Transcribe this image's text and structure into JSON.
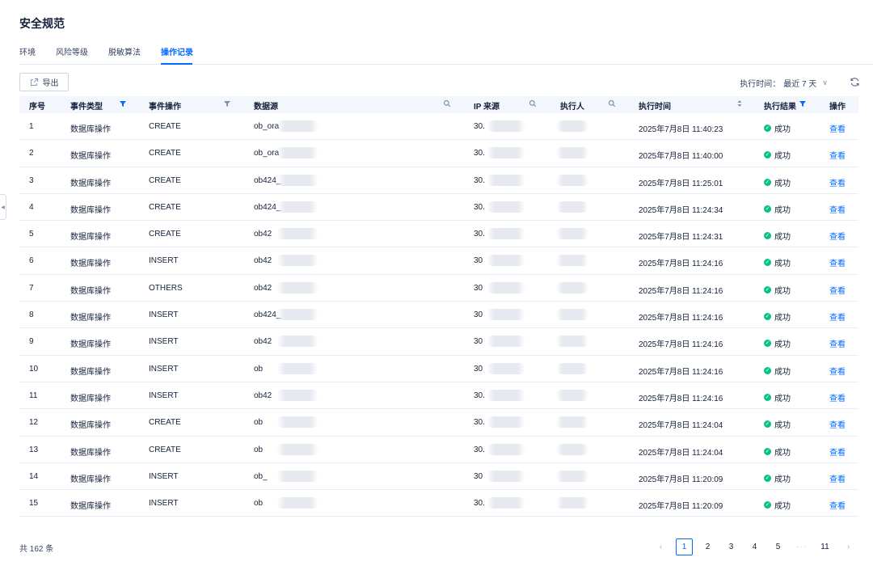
{
  "page": {
    "title": "安全规范",
    "tabs": [
      "环境",
      "风险等级",
      "脱敏算法",
      "操作记录"
    ],
    "active_tab": "操作记录"
  },
  "toolbar": {
    "export_label": "导出",
    "time_filter_label": "执行时间：",
    "time_filter_value": "最近 7 天"
  },
  "table": {
    "columns": {
      "index": "序号",
      "event_type": "事件类型",
      "event_op": "事件操作",
      "datasource": "数据源",
      "ip": "IP 来源",
      "executor": "执行人",
      "time": "执行时间",
      "result": "执行结果",
      "action": "操作"
    },
    "rows": [
      {
        "index": "1",
        "event_type": "数据库操作",
        "event_op": "CREATE",
        "datasource": "ob_ora",
        "ip": "30.",
        "time": "2025年7月8日 11:40:23",
        "result": "成功",
        "action": "查看"
      },
      {
        "index": "2",
        "event_type": "数据库操作",
        "event_op": "CREATE",
        "datasource": "ob_ora",
        "ip": "30.",
        "time": "2025年7月8日 11:40:00",
        "result": "成功",
        "action": "查看"
      },
      {
        "index": "3",
        "event_type": "数据库操作",
        "event_op": "CREATE",
        "datasource": "ob424_",
        "ip": "30.",
        "time": "2025年7月8日 11:25:01",
        "result": "成功",
        "action": "查看"
      },
      {
        "index": "4",
        "event_type": "数据库操作",
        "event_op": "CREATE",
        "datasource": "ob424_",
        "ip": "30.",
        "time": "2025年7月8日 11:24:34",
        "result": "成功",
        "action": "查看"
      },
      {
        "index": "5",
        "event_type": "数据库操作",
        "event_op": "CREATE",
        "datasource": "ob42",
        "ip": "30.",
        "time": "2025年7月8日 11:24:31",
        "result": "成功",
        "action": "查看"
      },
      {
        "index": "6",
        "event_type": "数据库操作",
        "event_op": "INSERT",
        "datasource": "ob42",
        "ip": "30",
        "time": "2025年7月8日 11:24:16",
        "result": "成功",
        "action": "查看"
      },
      {
        "index": "7",
        "event_type": "数据库操作",
        "event_op": "OTHERS",
        "datasource": "ob42",
        "ip": "30",
        "time": "2025年7月8日 11:24:16",
        "result": "成功",
        "action": "查看"
      },
      {
        "index": "8",
        "event_type": "数据库操作",
        "event_op": "INSERT",
        "datasource": "ob424_",
        "ip": "30",
        "time": "2025年7月8日 11:24:16",
        "result": "成功",
        "action": "查看"
      },
      {
        "index": "9",
        "event_type": "数据库操作",
        "event_op": "INSERT",
        "datasource": "ob42",
        "ip": "30",
        "time": "2025年7月8日 11:24:16",
        "result": "成功",
        "action": "查看"
      },
      {
        "index": "10",
        "event_type": "数据库操作",
        "event_op": "INSERT",
        "datasource": "ob",
        "ip": "30",
        "time": "2025年7月8日 11:24:16",
        "result": "成功",
        "action": "查看"
      },
      {
        "index": "11",
        "event_type": "数据库操作",
        "event_op": "INSERT",
        "datasource": "ob42",
        "ip": "30.",
        "time": "2025年7月8日 11:24:16",
        "result": "成功",
        "action": "查看"
      },
      {
        "index": "12",
        "event_type": "数据库操作",
        "event_op": "CREATE",
        "datasource": "ob",
        "ip": "30.",
        "time": "2025年7月8日 11:24:04",
        "result": "成功",
        "action": "查看"
      },
      {
        "index": "13",
        "event_type": "数据库操作",
        "event_op": "CREATE",
        "datasource": "ob",
        "ip": "30.",
        "time": "2025年7月8日 11:24:04",
        "result": "成功",
        "action": "查看"
      },
      {
        "index": "14",
        "event_type": "数据库操作",
        "event_op": "INSERT",
        "datasource": "ob_",
        "ip": "30",
        "time": "2025年7月8日 11:20:09",
        "result": "成功",
        "action": "查看"
      },
      {
        "index": "15",
        "event_type": "数据库操作",
        "event_op": "INSERT",
        "datasource": "ob",
        "ip": "30.",
        "time": "2025年7月8日 11:20:09",
        "result": "成功",
        "action": "查看"
      }
    ]
  },
  "footer": {
    "total_label": "共 162 条",
    "pages": [
      "1",
      "2",
      "3",
      "4",
      "5",
      "···",
      "11"
    ],
    "current_page": "1"
  },
  "icons": {
    "filter": "filter-icon",
    "search": "search-icon",
    "sort": "sort-icon",
    "export": "export-icon",
    "refresh": "refresh-icon",
    "success": "check-circle-icon"
  },
  "colors": {
    "accent": "#006aff",
    "success": "#0ac185",
    "header_bg": "#f3f6fc",
    "text": "#132039"
  }
}
